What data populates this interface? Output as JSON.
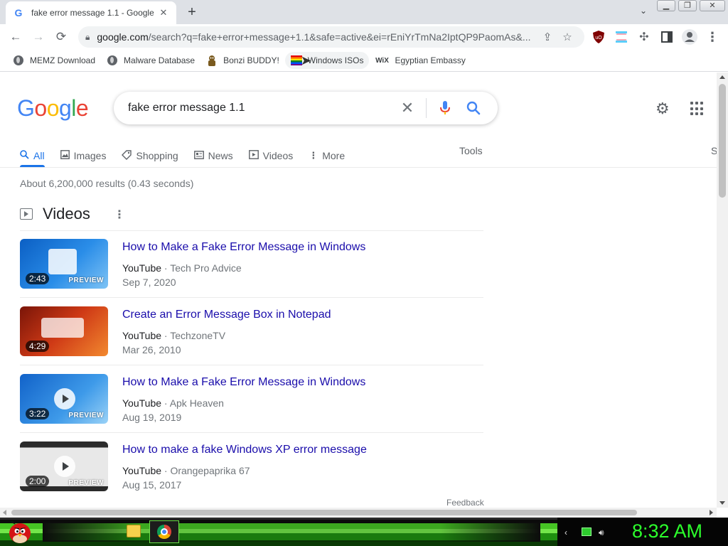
{
  "browser": {
    "tab_title": "fake error message 1.1 - Google",
    "tab_close": "✕",
    "new_tab": "+",
    "url_host": "google.com",
    "url_rest": "/search?q=fake+error+message+1.1&safe=active&ei=rEniYrTmNa2IptQP9PaomAs&...",
    "winctl": {
      "minimize": "▁",
      "restore": "❐",
      "close": "✕"
    }
  },
  "bookmarks": [
    {
      "label": "MEMZ Download",
      "icon": "globe-icon"
    },
    {
      "label": "Malware Database",
      "icon": "globe-icon"
    },
    {
      "label": "Bonzi BUDDY!",
      "icon": "bonzi-icon"
    },
    {
      "label": "Windows ISOs",
      "icon": "rainbow-flag-icon"
    },
    {
      "label": "Egyptian Embassy",
      "icon": "wix-icon"
    }
  ],
  "search": {
    "logo": [
      "G",
      "o",
      "o",
      "g",
      "l",
      "e"
    ],
    "logo_colors": [
      "#4285f4",
      "#ea4335",
      "#fbbc05",
      "#4285f4",
      "#34a853",
      "#ea4335"
    ],
    "query": "fake error message 1.1",
    "tabs": [
      {
        "label": "All",
        "icon": "search-icon"
      },
      {
        "label": "Images",
        "icon": "image-icon"
      },
      {
        "label": "Shopping",
        "icon": "tag-icon"
      },
      {
        "label": "News",
        "icon": "news-icon"
      },
      {
        "label": "Videos",
        "icon": "video-icon"
      },
      {
        "label": "More",
        "icon": "more-vert-icon"
      }
    ],
    "tools": "Tools",
    "cut_label": "S",
    "stats": "About 6,200,000 results (0.43 seconds)"
  },
  "videos": {
    "section_title": "Videos",
    "items": [
      {
        "title": "How to Make a Fake Error Message in Windows",
        "source": "YouTube",
        "channel": "Tech Pro Advice",
        "date": "Sep 7, 2020",
        "duration": "2:43",
        "preview": "PREVIEW"
      },
      {
        "title": "Create an Error Message Box in Notepad",
        "source": "YouTube",
        "channel": "TechzoneTV",
        "date": "Mar 26, 2010",
        "duration": "4:29",
        "preview": ""
      },
      {
        "title": "How to Make a Fake Error Message in Windows",
        "source": "YouTube",
        "channel": "Apk Heaven",
        "date": "Aug 19, 2019",
        "duration": "3:22",
        "preview": "PREVIEW"
      },
      {
        "title": "How to make a fake Windows XP error message",
        "source": "YouTube",
        "channel": "Orangepaprika 67",
        "date": "Aug 15, 2017",
        "duration": "2:00",
        "preview": "PREVIEW"
      }
    ],
    "feedback": "Feedback"
  },
  "taskbar": {
    "clock": "8:32 AM"
  },
  "colors": {
    "link": "#1a0dab",
    "accent": "#1a73e8",
    "clock": "#2cff2c"
  }
}
